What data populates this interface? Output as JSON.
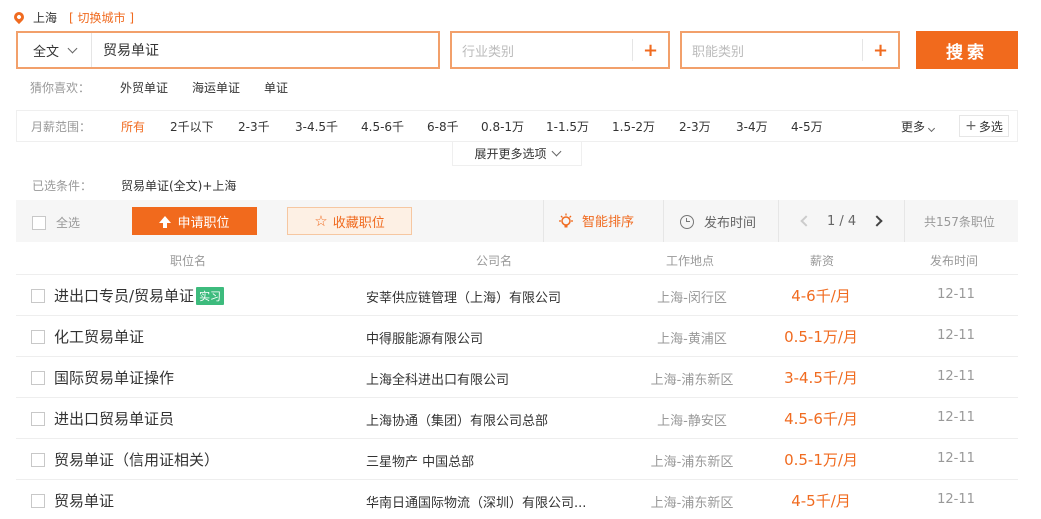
{
  "location": {
    "city": "上海",
    "switch_label": "[ 切换城市 ]"
  },
  "search": {
    "scope": "全文",
    "query": "贸易单证",
    "industry_placeholder": "行业类别",
    "function_placeholder": "职能类别",
    "plus": "+",
    "button": "搜索"
  },
  "guess": {
    "label": "猜你喜欢：",
    "keywords": [
      "外贸单证",
      "海运单证",
      "单证"
    ]
  },
  "salary": {
    "label": "月薪范围：",
    "options": [
      "所有",
      "2千以下",
      "2-3千",
      "3-4.5千",
      "4.5-6千",
      "6-8千",
      "0.8-1万",
      "1-1.5万",
      "1.5-2万",
      "2-3万",
      "3-4万",
      "4-5万"
    ],
    "more": "更多",
    "multi": "多选"
  },
  "expand_label": "展开更多选项",
  "chosen": {
    "label": "已选条件：",
    "value": "贸易单证(全文)+上海"
  },
  "toolbar": {
    "select_all": "全选",
    "apply": "申请职位",
    "favorite": "收藏职位",
    "smart_sort": "智能排序",
    "pub_time": "发布时间",
    "page": "1 / 4",
    "total": "共157条职位"
  },
  "columns": [
    "职位名",
    "公司名",
    "工作地点",
    "薪资",
    "发布时间"
  ],
  "jobs": [
    {
      "title": "进出口专员/贸易单证",
      "tag": "实习",
      "company": "安莘供应链管理（上海）有限公司",
      "location": "上海-闵行区",
      "salary": "4-6千/月",
      "date": "12-11"
    },
    {
      "title": "化工贸易单证",
      "tag": "",
      "company": "中得服能源有限公司",
      "location": "上海-黄浦区",
      "salary": "0.5-1万/月",
      "date": "12-11"
    },
    {
      "title": "国际贸易单证操作",
      "tag": "",
      "company": "上海全科进出口有限公司",
      "location": "上海-浦东新区",
      "salary": "3-4.5千/月",
      "date": "12-11"
    },
    {
      "title": "进出口贸易单证员",
      "tag": "",
      "company": "上海协通（集团）有限公司总部",
      "location": "上海-静安区",
      "salary": "4.5-6千/月",
      "date": "12-11"
    },
    {
      "title": "贸易单证（信用证相关）",
      "tag": "",
      "company": "三星物产 中国总部",
      "location": "上海-浦东新区",
      "salary": "0.5-1万/月",
      "date": "12-11"
    },
    {
      "title": "贸易单证",
      "tag": "",
      "company": "华南日通国际物流（深圳）有限公司...",
      "location": "上海-浦东新区",
      "salary": "4-5千/月",
      "date": "12-11"
    }
  ],
  "colors": {
    "accent": "#f06b20",
    "button": "#f16a1d",
    "tag": "#3dbb7d"
  }
}
